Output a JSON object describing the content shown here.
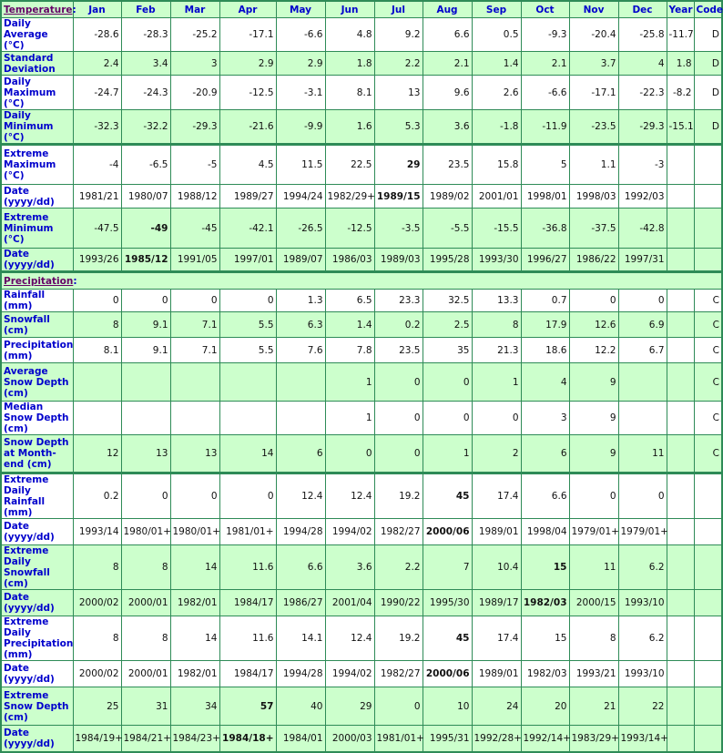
{
  "header": {
    "temperature_label": "Temperature",
    "colon": ":",
    "months": [
      "Jan",
      "Feb",
      "Mar",
      "Apr",
      "May",
      "Jun",
      "Jul",
      "Aug",
      "Sep",
      "Oct",
      "Nov",
      "Dec"
    ],
    "year": "Year",
    "code": "Code"
  },
  "precipitation_label": "Precipitation",
  "temperature_rows": [
    {
      "label": "Daily Average (°C)",
      "values": [
        "-28.6",
        "-28.3",
        "-25.2",
        "-17.1",
        "-6.6",
        "4.8",
        "9.2",
        "6.6",
        "0.5",
        "-9.3",
        "-20.4",
        "-25.8"
      ],
      "year": "-11.7",
      "code": "D",
      "bg": "white",
      "bold": []
    },
    {
      "label": "Standard Deviation",
      "values": [
        "2.4",
        "3.4",
        "3",
        "2.9",
        "2.9",
        "1.8",
        "2.2",
        "2.1",
        "1.4",
        "2.1",
        "3.7",
        "4"
      ],
      "year": "1.8",
      "code": "D",
      "bg": "green",
      "bold": []
    },
    {
      "label": "Daily Maximum (°C)",
      "values": [
        "-24.7",
        "-24.3",
        "-20.9",
        "-12.5",
        "-3.1",
        "8.1",
        "13",
        "9.6",
        "2.6",
        "-6.6",
        "-17.1",
        "-22.3"
      ],
      "year": "-8.2",
      "code": "D",
      "bg": "white",
      "bold": []
    },
    {
      "label": "Daily Minimum (°C)",
      "values": [
        "-32.3",
        "-32.2",
        "-29.3",
        "-21.6",
        "-9.9",
        "1.6",
        "5.3",
        "3.6",
        "-1.8",
        "-11.9",
        "-23.5",
        "-29.3"
      ],
      "year": "-15.1",
      "code": "D",
      "bg": "green",
      "bold": []
    },
    {
      "label": "Extreme Maximum (°C)",
      "values": [
        "-4",
        "-6.5",
        "-5",
        "4.5",
        "11.5",
        "22.5",
        "29",
        "23.5",
        "15.8",
        "5",
        "1.1",
        "-3"
      ],
      "year": "",
      "code": "",
      "bg": "white",
      "bold": [
        6
      ],
      "group_start": true
    },
    {
      "label": "Date (yyyy/dd)",
      "values": [
        "1981/21",
        "1980/07",
        "1988/12",
        "1989/27",
        "1994/24",
        "1982/29+",
        "1989/15",
        "1989/02",
        "2001/01",
        "1998/01",
        "1998/03",
        "1992/03"
      ],
      "year": "",
      "code": "",
      "bg": "white",
      "bold": [
        6
      ]
    },
    {
      "label": "Extreme Minimum (°C)",
      "values": [
        "-47.5",
        "-49",
        "-45",
        "-42.1",
        "-26.5",
        "-12.5",
        "-3.5",
        "-5.5",
        "-15.5",
        "-36.8",
        "-37.5",
        "-42.8"
      ],
      "year": "",
      "code": "",
      "bg": "green",
      "bold": [
        1
      ]
    },
    {
      "label": "Date (yyyy/dd)",
      "values": [
        "1993/26",
        "1985/12",
        "1991/05",
        "1997/01",
        "1989/07",
        "1986/03",
        "1989/03",
        "1995/28",
        "1993/30",
        "1996/27",
        "1986/22",
        "1997/31"
      ],
      "year": "",
      "code": "",
      "bg": "green",
      "bold": [
        1
      ]
    }
  ],
  "precipitation_rows": [
    {
      "label": "Rainfall (mm)",
      "values": [
        "0",
        "0",
        "0",
        "0",
        "1.3",
        "6.5",
        "23.3",
        "32.5",
        "13.3",
        "0.7",
        "0",
        "0"
      ],
      "year": "",
      "code": "C",
      "bg": "white",
      "bold": []
    },
    {
      "label": "Snowfall (cm)",
      "values": [
        "8",
        "9.1",
        "7.1",
        "5.5",
        "6.3",
        "1.4",
        "0.2",
        "2.5",
        "8",
        "17.9",
        "12.6",
        "6.9"
      ],
      "year": "",
      "code": "C",
      "bg": "green",
      "bold": []
    },
    {
      "label": "Precipitation (mm)",
      "values": [
        "8.1",
        "9.1",
        "7.1",
        "5.5",
        "7.6",
        "7.8",
        "23.5",
        "35",
        "21.3",
        "18.6",
        "12.2",
        "6.7"
      ],
      "year": "",
      "code": "C",
      "bg": "white",
      "bold": []
    },
    {
      "label": "Average Snow Depth (cm)",
      "values": [
        "",
        "",
        "",
        "",
        "",
        "1",
        "0",
        "0",
        "1",
        "4",
        "9",
        ""
      ],
      "year": "",
      "code": "C",
      "bg": "green",
      "bold": []
    },
    {
      "label": "Median Snow Depth (cm)",
      "values": [
        "",
        "",
        "",
        "",
        "",
        "1",
        "0",
        "0",
        "0",
        "3",
        "9",
        ""
      ],
      "year": "",
      "code": "C",
      "bg": "white",
      "bold": []
    },
    {
      "label": "Snow Depth at Month-end (cm)",
      "values": [
        "12",
        "13",
        "13",
        "14",
        "6",
        "0",
        "0",
        "1",
        "2",
        "6",
        "9",
        "11"
      ],
      "year": "",
      "code": "C",
      "bg": "green",
      "bold": []
    },
    {
      "label": "Extreme Daily Rainfall (mm)",
      "values": [
        "0.2",
        "0",
        "0",
        "0",
        "12.4",
        "12.4",
        "19.2",
        "45",
        "17.4",
        "6.6",
        "0",
        "0"
      ],
      "year": "",
      "code": "",
      "bg": "white",
      "bold": [
        7
      ],
      "group_start": true
    },
    {
      "label": "Date (yyyy/dd)",
      "values": [
        "1993/14",
        "1980/01+",
        "1980/01+",
        "1981/01+",
        "1994/28",
        "1994/02",
        "1982/27",
        "2000/06",
        "1989/01",
        "1998/04",
        "1979/01+",
        "1979/01+"
      ],
      "year": "",
      "code": "",
      "bg": "white",
      "bold": [
        7
      ]
    },
    {
      "label": "Extreme Daily Snowfall (cm)",
      "values": [
        "8",
        "8",
        "14",
        "11.6",
        "6.6",
        "3.6",
        "2.2",
        "7",
        "10.4",
        "15",
        "11",
        "6.2"
      ],
      "year": "",
      "code": "",
      "bg": "green",
      "bold": [
        9
      ]
    },
    {
      "label": "Date (yyyy/dd)",
      "values": [
        "2000/02",
        "2000/01",
        "1982/01",
        "1984/17",
        "1986/27",
        "2001/04",
        "1990/22",
        "1995/30",
        "1989/17",
        "1982/03",
        "2000/15",
        "1993/10"
      ],
      "year": "",
      "code": "",
      "bg": "green",
      "bold": [
        9
      ]
    },
    {
      "label": "Extreme Daily Precipitation (mm)",
      "values": [
        "8",
        "8",
        "14",
        "11.6",
        "14.1",
        "12.4",
        "19.2",
        "45",
        "17.4",
        "15",
        "8",
        "6.2"
      ],
      "year": "",
      "code": "",
      "bg": "white",
      "bold": [
        7
      ]
    },
    {
      "label": "Date (yyyy/dd)",
      "values": [
        "2000/02",
        "2000/01",
        "1982/01",
        "1984/17",
        "1994/28",
        "1994/02",
        "1982/27",
        "2000/06",
        "1989/01",
        "1982/03",
        "1993/21",
        "1993/10"
      ],
      "year": "",
      "code": "",
      "bg": "white",
      "bold": [
        7
      ]
    },
    {
      "label": "Extreme Snow Depth (cm)",
      "values": [
        "25",
        "31",
        "34",
        "57",
        "40",
        "29",
        "0",
        "10",
        "24",
        "20",
        "21",
        "22"
      ],
      "year": "",
      "code": "",
      "bg": "green",
      "bold": [
        3
      ]
    },
    {
      "label": "Date (yyyy/dd)",
      "values": [
        "1984/19+",
        "1984/21+",
        "1984/23+",
        "1984/18+",
        "1984/01",
        "2000/03",
        "1981/01+",
        "1995/31",
        "1992/28+",
        "1992/14+",
        "1983/29+",
        "1993/14+"
      ],
      "year": "",
      "code": "",
      "bg": "green",
      "bold": [
        3
      ]
    }
  ]
}
